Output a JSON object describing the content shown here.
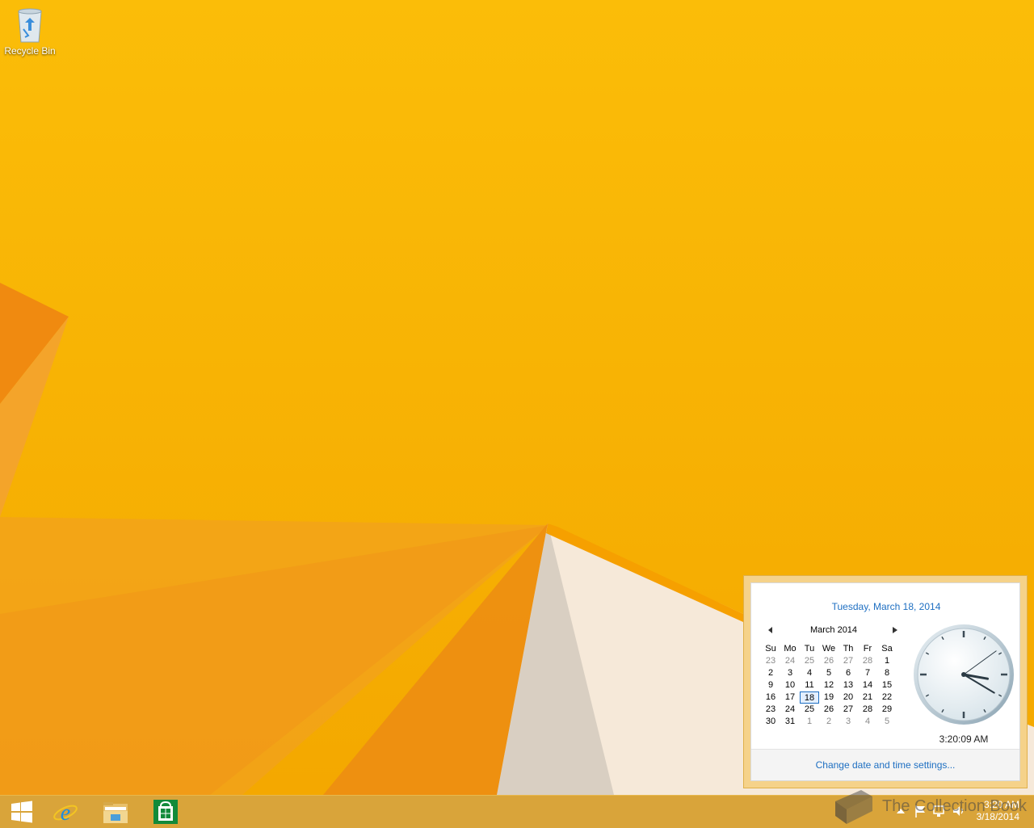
{
  "desktop": {
    "icons": [
      {
        "label": "Recycle Bin",
        "icon": "recycle-bin-icon"
      }
    ]
  },
  "taskbar": {
    "pinned": [
      {
        "name": "start-button",
        "icon": "windows-logo-icon"
      },
      {
        "name": "internet-explorer-button",
        "icon": "internet-explorer-icon"
      },
      {
        "name": "file-explorer-button",
        "icon": "folder-icon"
      },
      {
        "name": "store-button",
        "icon": "store-bag-icon"
      }
    ],
    "tray": {
      "time": "3:20 AM",
      "date": "3/18/2014",
      "icons": [
        "show-hidden-icons-chevron",
        "action-center-flag-icon",
        "network-icon",
        "volume-icon"
      ]
    },
    "watermark_text": "The Collection Book"
  },
  "flyout": {
    "long_date": "Tuesday, March 18, 2014",
    "calendar": {
      "month_label": "March 2014",
      "weekdays": [
        "Su",
        "Mo",
        "Tu",
        "We",
        "Th",
        "Fr",
        "Sa"
      ],
      "weeks": [
        [
          "23",
          "24",
          "25",
          "26",
          "27",
          "28",
          "1"
        ],
        [
          "2",
          "3",
          "4",
          "5",
          "6",
          "7",
          "8"
        ],
        [
          "9",
          "10",
          "11",
          "12",
          "13",
          "14",
          "15"
        ],
        [
          "16",
          "17",
          "18",
          "19",
          "20",
          "21",
          "22"
        ],
        [
          "23",
          "24",
          "25",
          "26",
          "27",
          "28",
          "29"
        ],
        [
          "30",
          "31",
          "1",
          "2",
          "3",
          "4",
          "5"
        ]
      ],
      "selected_day": "18"
    },
    "digital_time": "3:20:09 AM",
    "change_link": "Change date and time settings..."
  },
  "colors": {
    "accent_link": "#1e6fc2",
    "wallpaper_yellow": "#f7b500"
  }
}
